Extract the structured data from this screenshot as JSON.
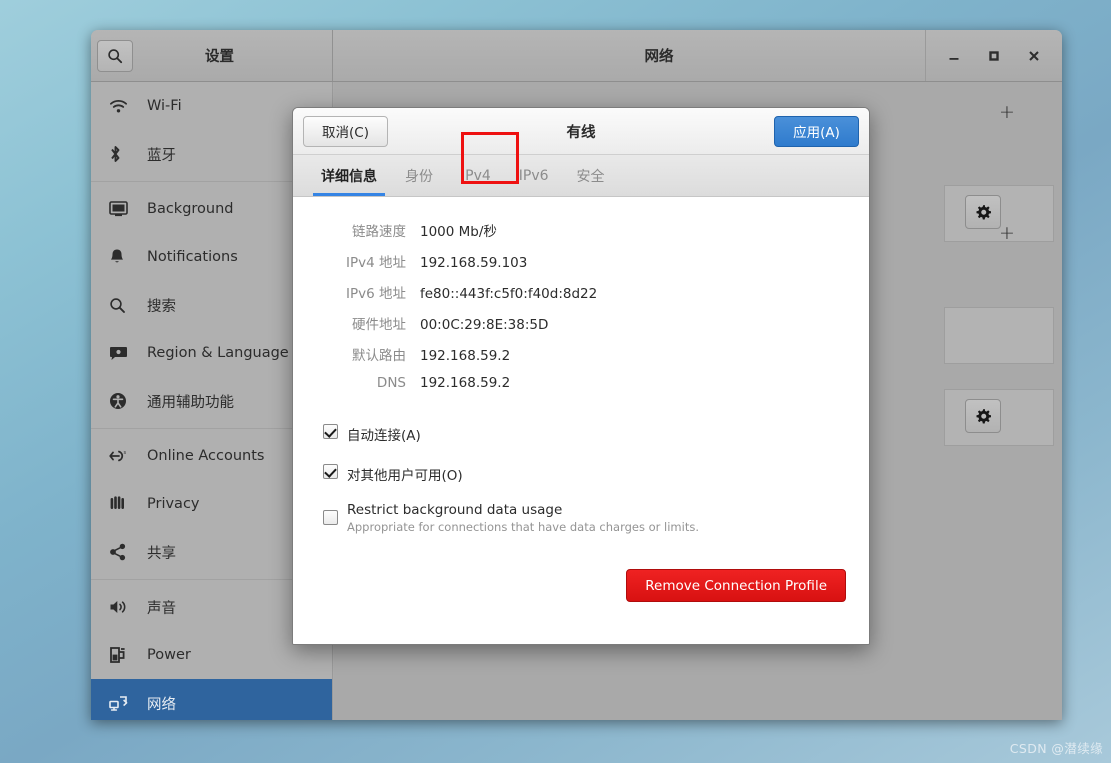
{
  "window": {
    "settings_title": "设置",
    "panel_title": "网络",
    "search_icon": "search-icon",
    "minimize_label": "_",
    "maximize_label": "□",
    "close_label": "✕"
  },
  "sidebar": {
    "items": [
      {
        "label": "Wi-Fi",
        "icon": "wifi-icon",
        "selected": false
      },
      {
        "label": "蓝牙",
        "icon": "bluetooth-icon",
        "selected": false
      },
      {
        "label": "Background",
        "icon": "background-icon",
        "selected": false
      },
      {
        "label": "Notifications",
        "icon": "bell-icon",
        "selected": false
      },
      {
        "label": "搜索",
        "icon": "search-icon",
        "selected": false
      },
      {
        "label": "Region & Language",
        "icon": "region-icon",
        "selected": false
      },
      {
        "label": "通用辅助功能",
        "icon": "accessibility-icon",
        "selected": false
      },
      {
        "label": "Online Accounts",
        "icon": "online-accounts-icon",
        "selected": false
      },
      {
        "label": "Privacy",
        "icon": "privacy-hand-icon",
        "selected": false
      },
      {
        "label": "共享",
        "icon": "share-icon",
        "selected": false
      },
      {
        "label": "声音",
        "icon": "sound-icon",
        "selected": false
      },
      {
        "label": "Power",
        "icon": "power-icon",
        "selected": false
      },
      {
        "label": "网络",
        "icon": "network-icon",
        "selected": true
      }
    ]
  },
  "main_panel": {
    "add_buttons": [
      "+",
      "+"
    ],
    "gear_icon": "gear-icon"
  },
  "dialog": {
    "title": "有线",
    "cancel_label": "取消(C)",
    "apply_label": "应用(A)",
    "tabs": [
      {
        "label": "详细信息",
        "active": true,
        "highlighted": false
      },
      {
        "label": "身份",
        "active": false,
        "highlighted": false
      },
      {
        "label": "IPv4",
        "active": false,
        "highlighted": true
      },
      {
        "label": "IPv6",
        "active": false,
        "highlighted": false
      },
      {
        "label": "安全",
        "active": false,
        "highlighted": false
      }
    ],
    "details": [
      {
        "label": "链路速度",
        "value": "1000 Mb/秒"
      },
      {
        "label": "IPv4 地址",
        "value": "192.168.59.103"
      },
      {
        "label": "IPv6 地址",
        "value": "fe80::443f:c5f0:f40d:8d22"
      },
      {
        "label": "硬件地址",
        "value": "00:0C:29:8E:38:5D"
      },
      {
        "label": "默认路由",
        "value": "192.168.59.2"
      },
      {
        "label": "DNS",
        "value": "192.168.59.2"
      }
    ],
    "checkboxes": [
      {
        "label": "自动连接(A)",
        "sub": "",
        "checked": true
      },
      {
        "label": "对其他用户可用(O)",
        "sub": "",
        "checked": true
      },
      {
        "label": "Restrict background data usage",
        "sub": "Appropriate for connections that have data charges or limits.",
        "checked": false
      }
    ],
    "remove_label": "Remove Connection Profile"
  },
  "watermark": {
    "text": "CSDN @潜续缘"
  },
  "colors": {
    "accent_blue": "#2f7bcd",
    "selected_row": "#2f649e",
    "danger_red": "#d81111",
    "highlight_red": "#ee1111",
    "tab_underline": "#3584e4"
  }
}
